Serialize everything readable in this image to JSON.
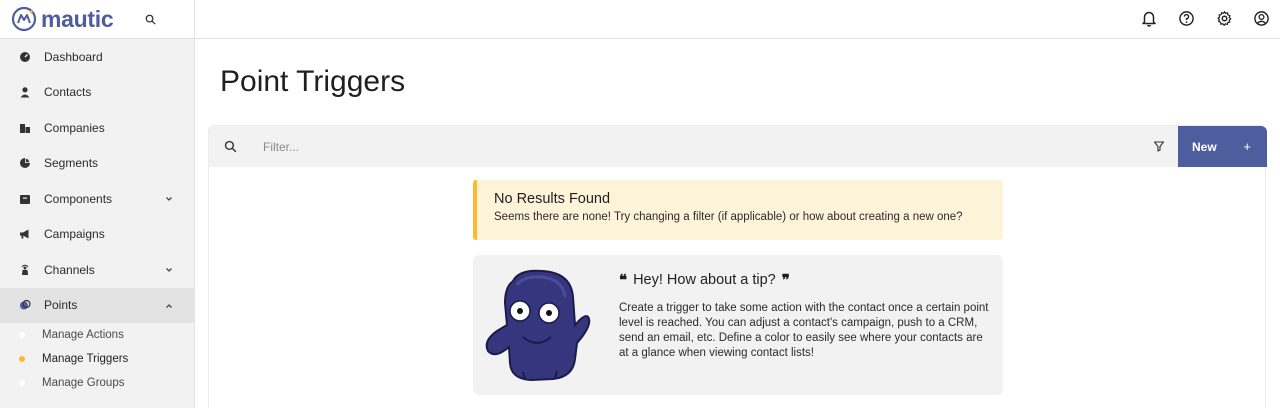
{
  "brand": {
    "name": "mautic",
    "logo_icon": "mautic-logo-icon",
    "search_icon": "search-icon"
  },
  "colors": {
    "brand": "#4e5d9d",
    "accent": "#fdb933",
    "alert_bg": "#fcf3d8"
  },
  "sidebar": {
    "items": [
      {
        "label": "Dashboard",
        "icon": "speedometer-icon"
      },
      {
        "label": "Contacts",
        "icon": "user-icon"
      },
      {
        "label": "Companies",
        "icon": "building-icon"
      },
      {
        "label": "Segments",
        "icon": "pie-chart-icon"
      },
      {
        "label": "Components",
        "icon": "archive-icon",
        "expandable": true
      },
      {
        "label": "Campaigns",
        "icon": "megaphone-icon"
      },
      {
        "label": "Channels",
        "icon": "rss-icon",
        "expandable": true
      },
      {
        "label": "Points",
        "icon": "coins-icon",
        "expandable": true,
        "expanded": true
      }
    ],
    "points_sub": [
      {
        "label": "Manage Actions"
      },
      {
        "label": "Manage Triggers",
        "current": true
      },
      {
        "label": "Manage Groups"
      }
    ]
  },
  "topbar": {
    "icons": [
      "bell-icon",
      "help-icon",
      "settings-icon",
      "account-icon"
    ]
  },
  "page": {
    "title": "Point Triggers"
  },
  "toolbar": {
    "filter_placeholder": "Filter...",
    "new_label": "New",
    "new_icon": "plus-icon"
  },
  "alert": {
    "title": "No Results Found",
    "text": "Seems there are none! Try changing a filter (if applicable) or how about creating a new one?"
  },
  "tip": {
    "open_quote": "❝",
    "title": "Hey! How about a tip?",
    "close_quote": "❞",
    "body": "Create a trigger to take some action with the contact once a certain point level is reached. You can adjust a contact's campaign, push to a CRM, send an email, etc. Define a color to easily see where your contacts are at a glance when viewing contact lists!"
  }
}
